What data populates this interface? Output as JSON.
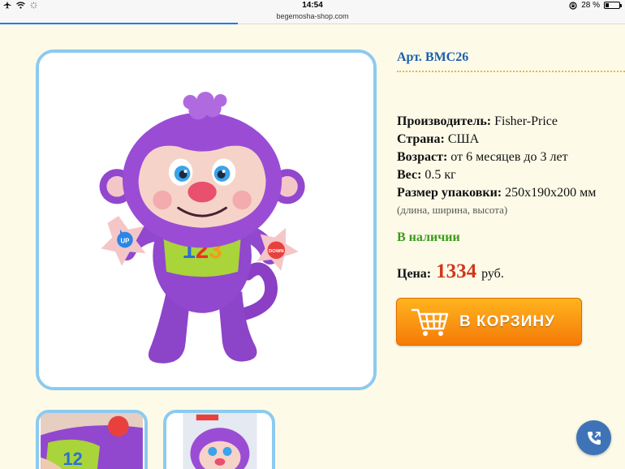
{
  "status_bar": {
    "time": "14:54",
    "battery": "28 %",
    "battery_level": 0.28
  },
  "browser": {
    "url": "begemosha-shop.com",
    "load_progress": 0.38
  },
  "product": {
    "article": "Арт. BMC26",
    "image_icon": "monkey-toy-photo",
    "specs": {
      "manufacturer_label": "Производитель:",
      "manufacturer_value": "Fisher-Price",
      "country_label": "Страна:",
      "country_value": "США",
      "age_label": "Возраст:",
      "age_value": "от 6 месяцев до 3 лет",
      "weight_label": "Вес:",
      "weight_value": "0.5 кг",
      "size_label": "Размер упаковки:",
      "size_value": "250x190x200 мм",
      "size_note": "(длина, ширина, высота)"
    },
    "availability": "В наличии",
    "price_label": "Цена:",
    "price_value": "1334",
    "price_currency": "руб.",
    "cart_button": "В КОРЗИНУ"
  },
  "colors": {
    "accent_blue": "#1d5faa",
    "price_red": "#d0381c",
    "stock_green": "#3a9b1c",
    "cart_orange": "#f57b08",
    "frame_blue": "#8ccaf0"
  },
  "icons": {
    "airplane": "airplane-icon",
    "wifi": "wifi-icon",
    "lock_rotation": "rotation-lock-icon",
    "cart": "shopping-cart-icon",
    "phone": "phone-icon"
  }
}
